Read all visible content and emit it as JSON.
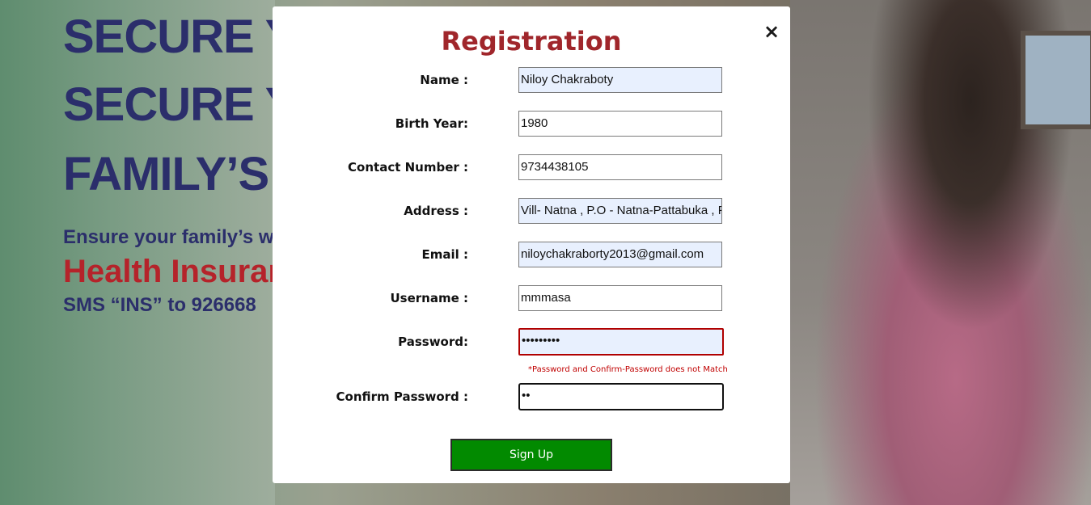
{
  "background": {
    "ad_lines": [
      "SECURE Y",
      "SECURE Y",
      "FAMILY’S"
    ],
    "ad_subline": "Ensure your family’s w",
    "ad_red": "Health Insuran",
    "ad_sms": "SMS “INS” to 926668"
  },
  "modal": {
    "title": "Registration",
    "close_icon": "×",
    "fields": [
      {
        "label": "Name :",
        "value": "Niloy Chakraboty"
      },
      {
        "label": "Birth Year:",
        "value": "1980"
      },
      {
        "label": "Contact Number :",
        "value": "9734438105"
      },
      {
        "label": "Address :",
        "value": "Vill- Natna , P.O - Natna-Pattabuka , F"
      },
      {
        "label": "Email :",
        "value": "niloychakraborty2013@gmail.com"
      },
      {
        "label": "Username :",
        "value": "mmmasa"
      },
      {
        "label": "Password:",
        "value": "•••••••••"
      },
      {
        "label": "Confirm Password :",
        "value": "••"
      }
    ],
    "error_message": "*Password and Confirm-Password does not Match",
    "submit_label": "Sign Up"
  }
}
